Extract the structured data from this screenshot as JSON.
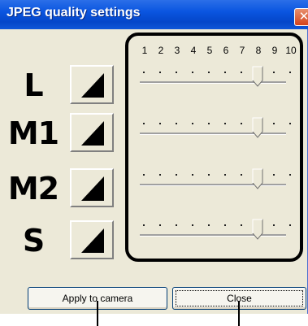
{
  "window": {
    "title": "JPEG quality settings",
    "close_glyph": "✕"
  },
  "scale_labels": [
    "1",
    "2",
    "3",
    "4",
    "5",
    "6",
    "7",
    "8",
    "9",
    "10"
  ],
  "rows": [
    {
      "label": "L",
      "icon": "quality-wedge-icon",
      "quality": 8
    },
    {
      "label": "M1",
      "icon": "quality-wedge-icon",
      "quality": 8
    },
    {
      "label": "M2",
      "icon": "quality-wedge-icon",
      "quality": 8
    },
    {
      "label": "S",
      "icon": "quality-wedge-icon",
      "quality": 8
    }
  ],
  "buttons": {
    "apply": "Apply to camera",
    "close": "Close"
  },
  "colors": {
    "title_bar": "#0a55e0",
    "dialog_bg": "#ece9d8",
    "close_button": "#d4421c",
    "highlight": "#000000"
  }
}
